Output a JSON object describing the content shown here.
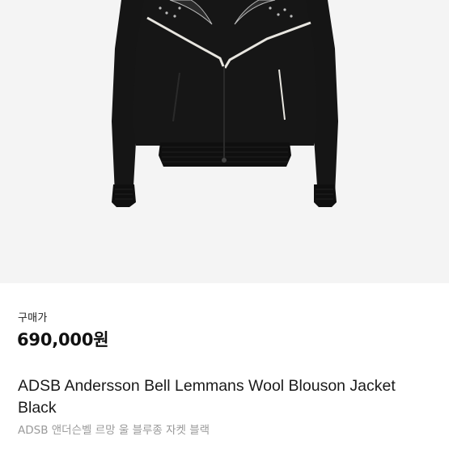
{
  "price": {
    "label": "구매가",
    "value": "690,000원"
  },
  "product": {
    "title": "ADSB Andersson Bell Lemmans Wool Blouson Jacket Black",
    "subtitle": "ADSB 앤더슨벨 르망 울 블루종 자켓 블랙"
  },
  "colors": {
    "image_background": "#f4f4f4",
    "jacket": "#141414",
    "piping": "#e8e6e0",
    "price_text": "#111111",
    "subtitle_text": "#9a9a9a"
  }
}
